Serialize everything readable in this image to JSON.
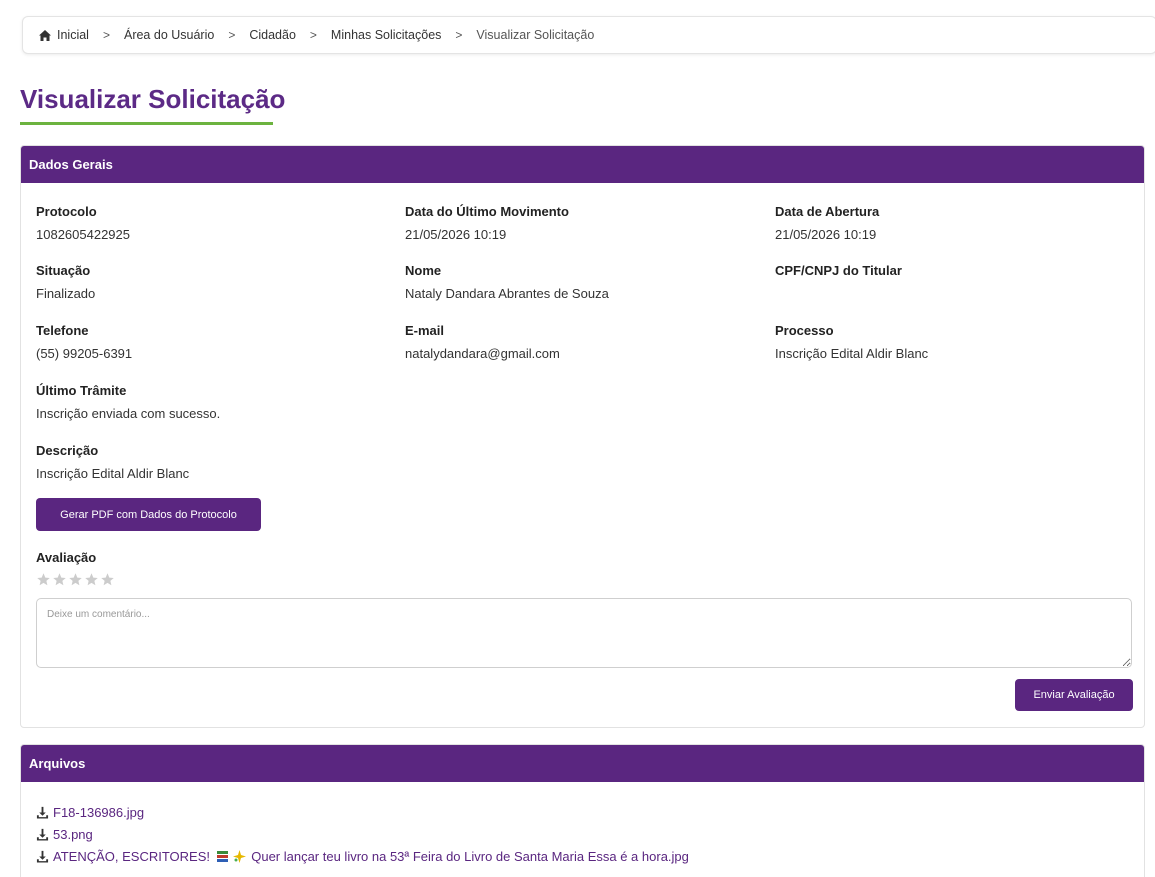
{
  "breadcrumb": {
    "items": [
      "Inicial",
      "Área do Usuário",
      "Cidadão",
      "Minhas Solicitações",
      "Visualizar Solicitação"
    ],
    "separator": ">"
  },
  "page": {
    "title": "Visualizar Solicitação"
  },
  "dados_gerais": {
    "header": "Dados Gerais",
    "fields": {
      "protocolo": {
        "label": "Protocolo",
        "value": "1082605422925"
      },
      "data_ultimo_movimento": {
        "label": "Data do Último Movimento",
        "value": "21/05/2026 10:19"
      },
      "data_abertura": {
        "label": "Data de Abertura",
        "value": "21/05/2026 10:19"
      },
      "situacao": {
        "label": "Situação",
        "value": "Finalizado"
      },
      "nome": {
        "label": "Nome",
        "value": "Nataly Dandara Abrantes de Souza"
      },
      "cpf_cnpj": {
        "label": "CPF/CNPJ do Titular",
        "value": ""
      },
      "telefone": {
        "label": "Telefone",
        "value": "(55) 99205-6391"
      },
      "email": {
        "label": "E-mail",
        "value": "natalydandara@gmail.com"
      },
      "processo": {
        "label": "Processo",
        "value": "Inscrição Edital Aldir Blanc"
      },
      "ultimo_tramite": {
        "label": "Último Trâmite",
        "value": "Inscrição enviada com sucesso."
      },
      "descricao": {
        "label": "Descrição",
        "value": "Inscrição Edital Aldir Blanc"
      }
    },
    "pdf_button_label": "Gerar PDF com Dados do Protocolo",
    "avaliacao": {
      "label": "Avaliação",
      "rating": 0,
      "max_rating": 5,
      "star_icon": "star-icon",
      "star_color_empty": "#cccccc",
      "comment_placeholder": "Deixe um comentário...",
      "comment_value": "",
      "submit_label": "Enviar Avaliação"
    }
  },
  "arquivos": {
    "header": "Arquivos",
    "files": [
      {
        "name": "F18-136986.jpg",
        "icon": "download-icon"
      },
      {
        "name": "53.png",
        "icon": "download-icon"
      },
      {
        "name_prefix": "ATENÇÃO, ESCRITORES! ",
        "name_suffix": " Quer lançar teu livro na 53ª Feira do Livro de Santa Maria Essa é a hora.jpg",
        "icon": "download-icon",
        "emoji_icons": [
          "books-icon",
          "sparkle-icon"
        ]
      }
    ]
  },
  "colors": {
    "primary": "#5a2680",
    "title": "#5c2a86",
    "accent_underline": "#6cb33f",
    "link": "#5a2680"
  }
}
